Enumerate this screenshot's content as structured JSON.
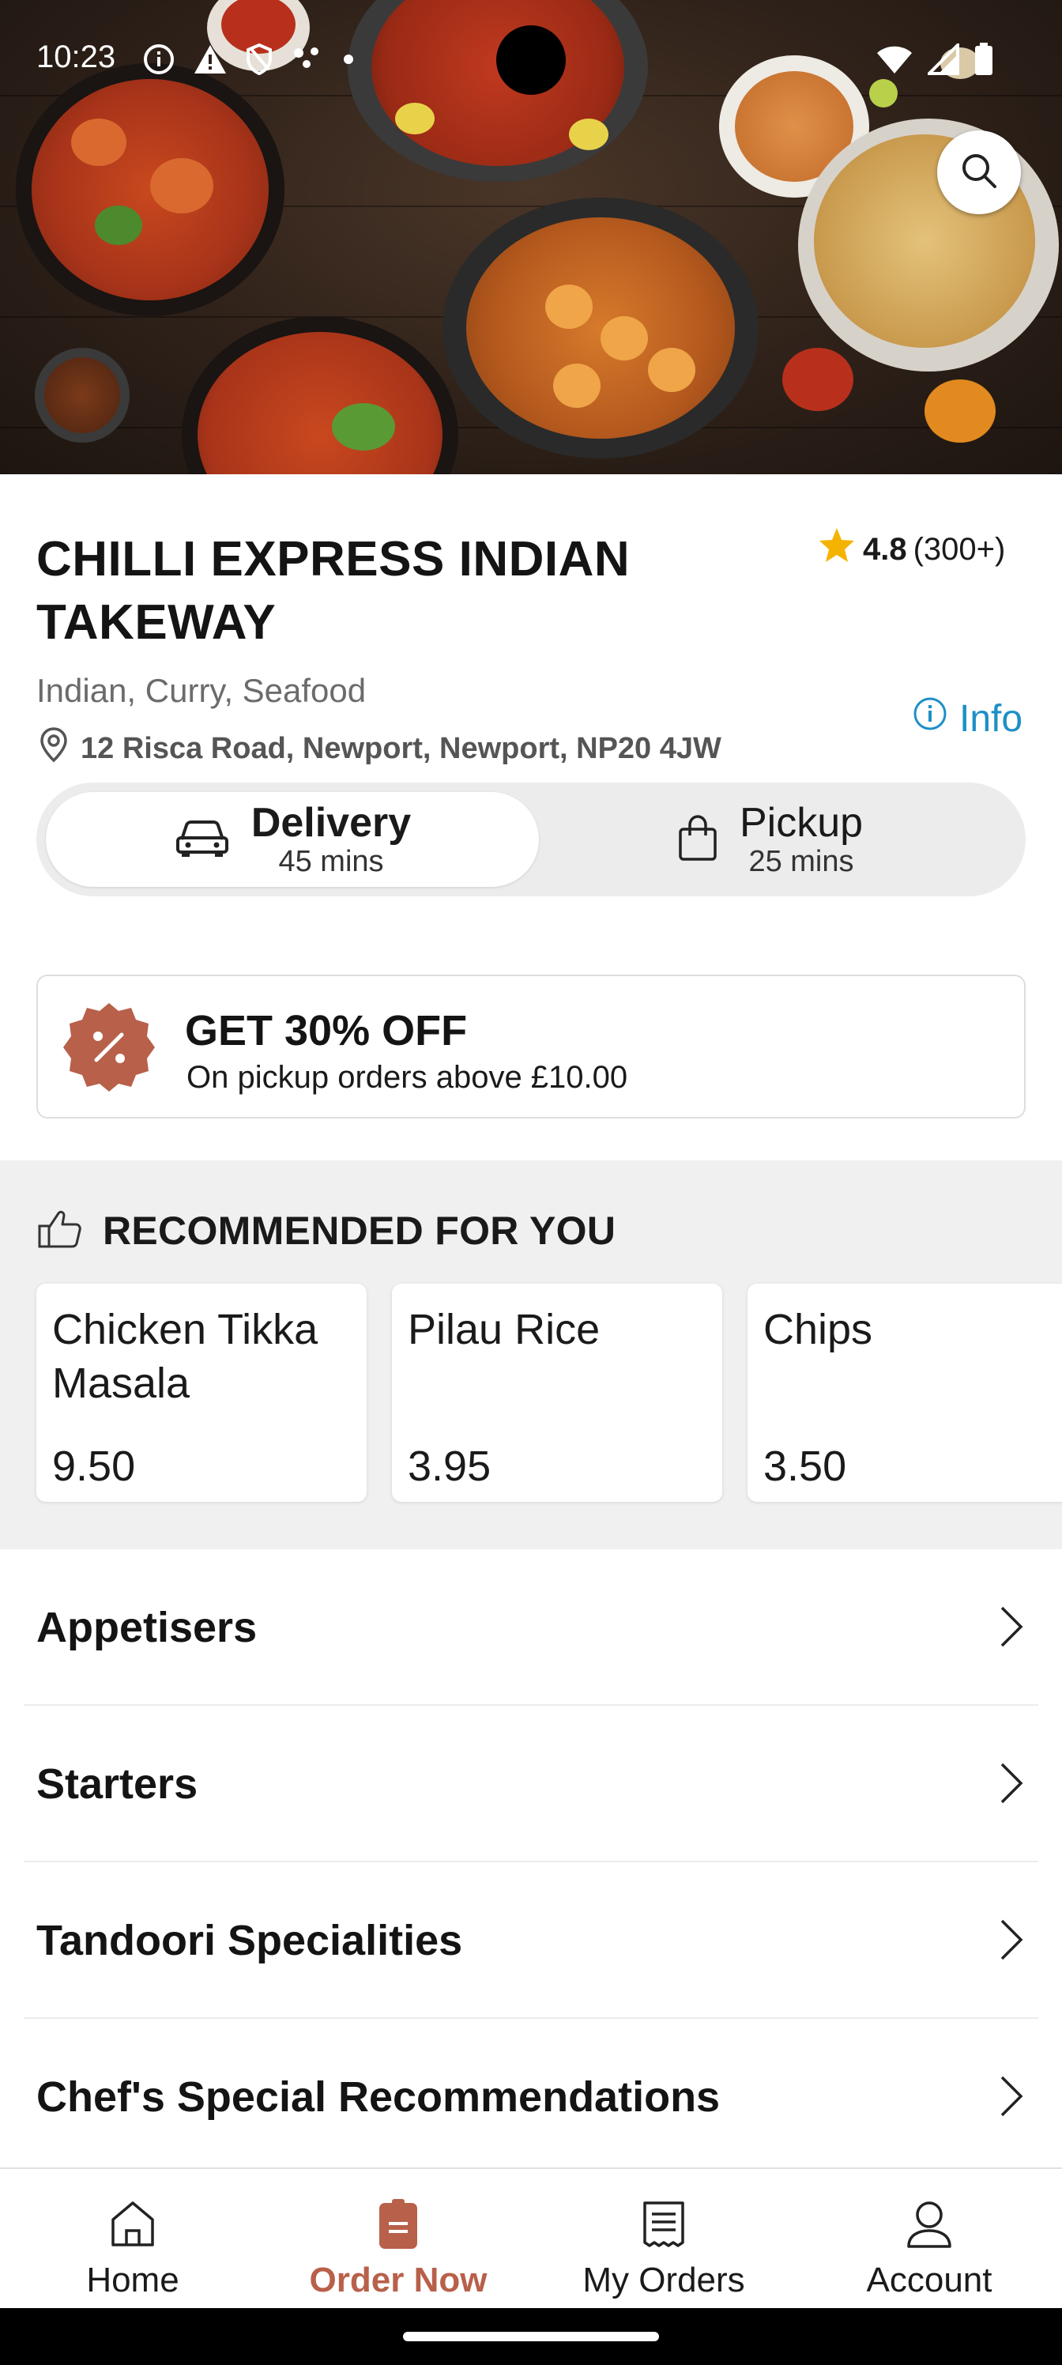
{
  "status_bar": {
    "time": "10:23"
  },
  "hero": {
    "search_icon": "search-icon"
  },
  "restaurant": {
    "name": "CHILLI EXPRESS INDIAN TAKEWAY",
    "rating": "4.8",
    "rating_count": "(300+)",
    "cuisines": "Indian, Curry, Seafood",
    "address": "12 Risca Road, Newport, Newport, NP20 4JW",
    "info_label": "Info"
  },
  "fulfilment": {
    "selected": "delivery",
    "delivery": {
      "label": "Delivery",
      "time": "45 mins"
    },
    "pickup": {
      "label": "Pickup",
      "time": "25 mins"
    }
  },
  "offer": {
    "title": "GET 30% OFF",
    "subtitle": "On pickup orders above £10.00"
  },
  "recommended": {
    "title": "RECOMMENDED FOR YOU",
    "items": [
      {
        "name": "Chicken Tikka Masala",
        "price": "9.50"
      },
      {
        "name": "Pilau Rice",
        "price": "3.95"
      },
      {
        "name": "Chips",
        "price": "3.50"
      }
    ]
  },
  "categories": [
    {
      "label": "Appetisers"
    },
    {
      "label": "Starters"
    },
    {
      "label": "Tandoori Specialities"
    },
    {
      "label": "Chef's Special Recommendations"
    }
  ],
  "bottom_nav": {
    "active": "order-now",
    "items": [
      {
        "label": "Home"
      },
      {
        "label": "Order Now"
      },
      {
        "label": "My Orders"
      },
      {
        "label": "Account"
      }
    ]
  },
  "colors": {
    "accent": "#b8604a",
    "info_link": "#1e8fc6",
    "star": "#f5b301",
    "section_bg": "#f0f0f0"
  }
}
